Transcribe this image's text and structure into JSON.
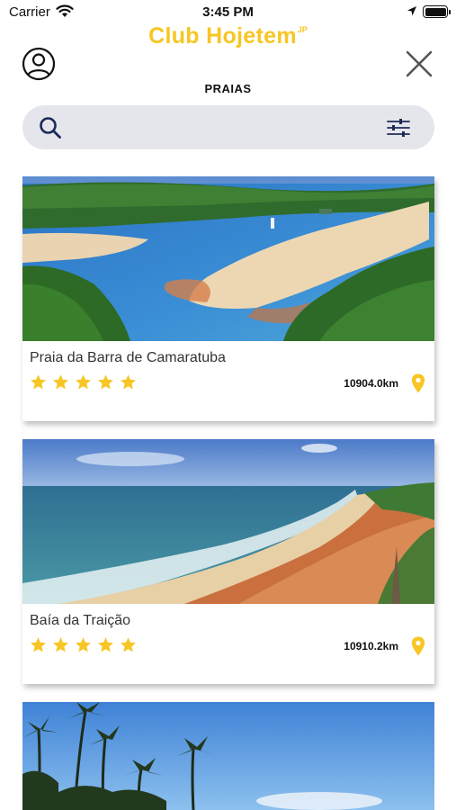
{
  "status_bar": {
    "carrier": "Carrier",
    "time": "3:45 PM"
  },
  "header": {
    "brand": "Club Hojetem",
    "brand_sup": "JP",
    "title": "PRAIAS"
  },
  "search": {
    "value": "",
    "placeholder": ""
  },
  "icons": {
    "profile": "user-circle-icon",
    "close": "close-icon",
    "search": "search-icon",
    "filter": "sliders-icon",
    "star": "star-icon",
    "pin": "map-pin-icon"
  },
  "colors": {
    "accent": "#f7c624",
    "search_bg": "#e5e6eb",
    "icon_blue": "#1c2a56"
  },
  "beaches": [
    {
      "name": "Praia da Barra de Camaratuba",
      "rating": 5,
      "distance": "10904.0km"
    },
    {
      "name": "Baía da Traição",
      "rating": 5,
      "distance": "10910.2km"
    },
    {
      "name": "",
      "rating": 0,
      "distance": ""
    }
  ]
}
